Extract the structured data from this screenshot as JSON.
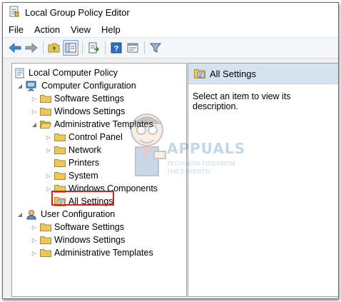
{
  "window": {
    "title": "Local Group Policy Editor"
  },
  "menu": [
    "File",
    "Action",
    "View",
    "Help"
  ],
  "toolbar": {
    "icons": [
      "back-arrow-icon",
      "forward-arrow-icon",
      "up-folder-icon",
      "show-hide-tree-icon",
      "export-list-icon",
      "help-icon",
      "properties-icon",
      "filter-icon"
    ]
  },
  "tree": {
    "root": "Local Computer Policy",
    "computer_config": {
      "label": "Computer Configuration",
      "software_settings": "Software Settings",
      "windows_settings": "Windows Settings",
      "admin_templates": {
        "label": "Administrative Templates",
        "children": [
          "Control Panel",
          "Network",
          "Printers",
          "System",
          "Windows Components"
        ],
        "all_settings": "All Settings"
      }
    },
    "user_config": {
      "label": "User Configuration",
      "children": [
        "Software Settings",
        "Windows Settings",
        "Administrative Templates"
      ]
    }
  },
  "detail": {
    "header": "All Settings",
    "description": "Select an item to view its description."
  },
  "watermark": {
    "brand": "APPUALS",
    "tagline_line1": "TECH HOW-TO'S FROM",
    "tagline_line2": "THE EXPERTS!"
  },
  "colors": {
    "highlight_border": "#d81e1e",
    "header_bg": "#d5e2f0",
    "folder": "#e8c45a"
  }
}
